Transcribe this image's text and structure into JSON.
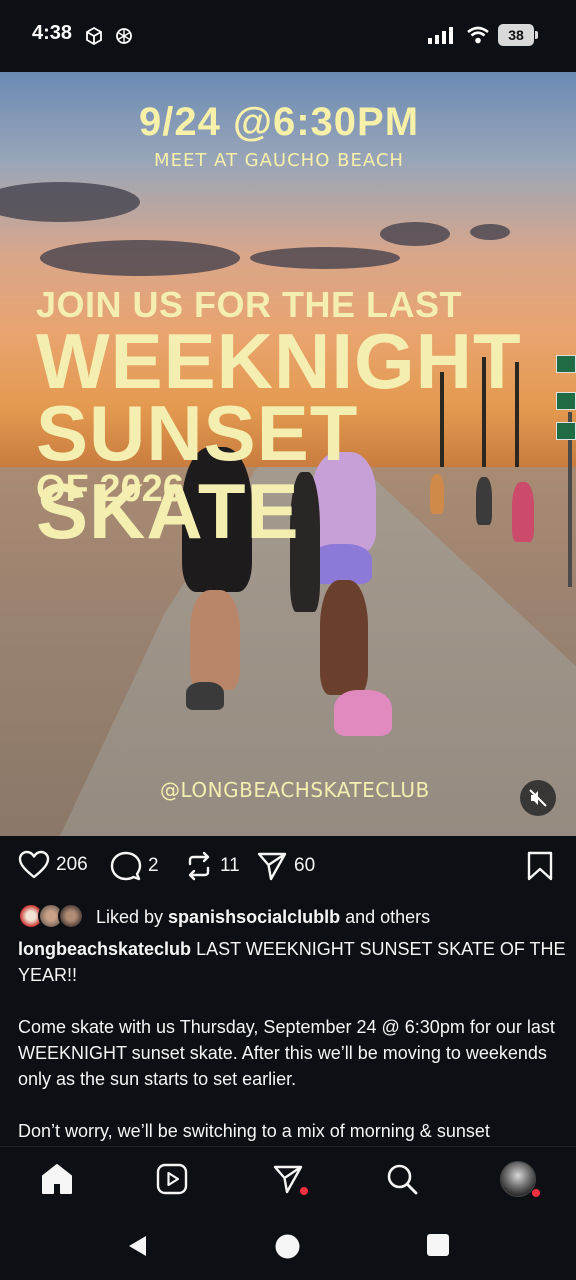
{
  "status_bar": {
    "time": "4:38",
    "battery": "38"
  },
  "poster": {
    "date_time": "9/24 @6:30PM",
    "meet_location": "MEET AT GAUCHO BEACH",
    "headline_top": "JOIN US FOR THE LAST",
    "headline_line1": "WEEKNIGHT",
    "headline_line2": "SUNSET SKATE",
    "headline_year": "OF 2026",
    "handle": "@LONGBEACHSKATECLUB"
  },
  "actions": {
    "likes_count": "206",
    "comments_count": "2",
    "reposts_count": "11",
    "shares_count": "60"
  },
  "liked_by": {
    "prefix": "Liked by",
    "user": "spanishsocialclublb",
    "suffix": "and others"
  },
  "caption": {
    "username": "longbeachskateclub",
    "line1": "LAST WEEKNIGHT SUNSET SKATE OF THE YEAR!!",
    "paragraph2": "Come skate with us Thursday, September 24 @ 6:30pm for our last WEEKNIGHT sunset skate. After this we’ll be moving to weekends only as the sun starts to set earlier.",
    "paragraph3": "Don’t worry, we’ll be switching to a mix of morning & sunset"
  },
  "colors": {
    "background": "#0c1014",
    "poster_text": "#f4eeb0",
    "notification_dot": "#ff3040"
  },
  "icons": [
    "heart-icon",
    "comment-icon",
    "repost-icon",
    "share-icon",
    "bookmark-icon",
    "mute-icon",
    "home-icon",
    "reels-icon",
    "messages-icon",
    "search-icon",
    "back-icon",
    "home-circle-icon",
    "recents-icon"
  ]
}
